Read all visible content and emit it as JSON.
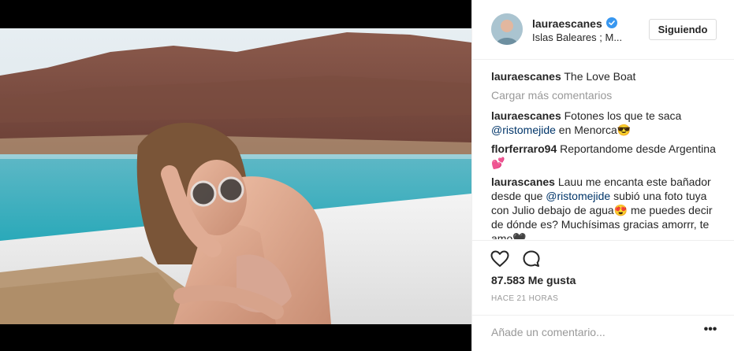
{
  "post": {
    "photo_alt": "Woman with sunglasses on a boat"
  },
  "header": {
    "username": "lauraescanes",
    "location": "Islas Baleares ; M...",
    "follow_label": "Siguiendo"
  },
  "caption": {
    "user": "lauraescanes",
    "text": "The Love Boat"
  },
  "load_more_label": "Cargar más comentarios",
  "comments": [
    {
      "user": "lauraescanes",
      "pre": "Fotones los que te saca ",
      "mention": "@ristomejide",
      "post": " en Menorca😎"
    },
    {
      "user": "florferraro94",
      "pre": "Reportandome desde Argentina💕",
      "mention": "",
      "post": ""
    },
    {
      "user": "laurascanes",
      "pre": "Lauu me encanta este bañador desde que ",
      "mention": "@ristomejide",
      "post": " subió una foto tuya con Julio debajo de agua😍 me puedes decir de dónde es? Muchísimas gracias amorrr, te amo🖤"
    }
  ],
  "likes": "87.583 Me gusta",
  "time_ago": "HACE 21 HORAS",
  "comment_input": {
    "placeholder": "Añade un comentario..."
  },
  "more_options": "•••",
  "icons": {
    "like": "heart-icon",
    "comment": "comment-icon",
    "verified": "verified-badge-icon",
    "more": "more-options-icon"
  },
  "colors": {
    "verified": "#3897f0",
    "mention": "#003569",
    "muted": "#999999"
  }
}
